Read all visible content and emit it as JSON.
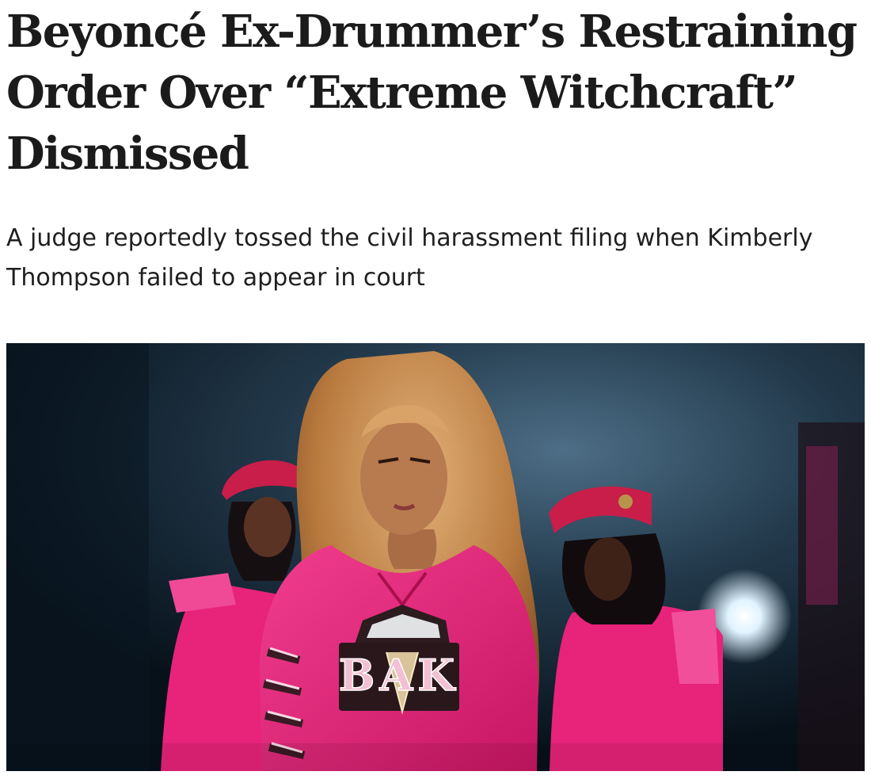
{
  "article": {
    "headline": "Beyoncé Ex-Drummer’s Restraining Order Over “Extreme Witchcraft” Dismissed",
    "dek": "A judge reportedly tossed the civil harassment filing when Kimberly Thompson failed to appear in court",
    "hero_image": {
      "jersey_lettering": "BAK",
      "colors": {
        "costume_pink": "#e8237a",
        "beret_red": "#c91d4a",
        "stage_background": "#0e1a24"
      }
    }
  }
}
